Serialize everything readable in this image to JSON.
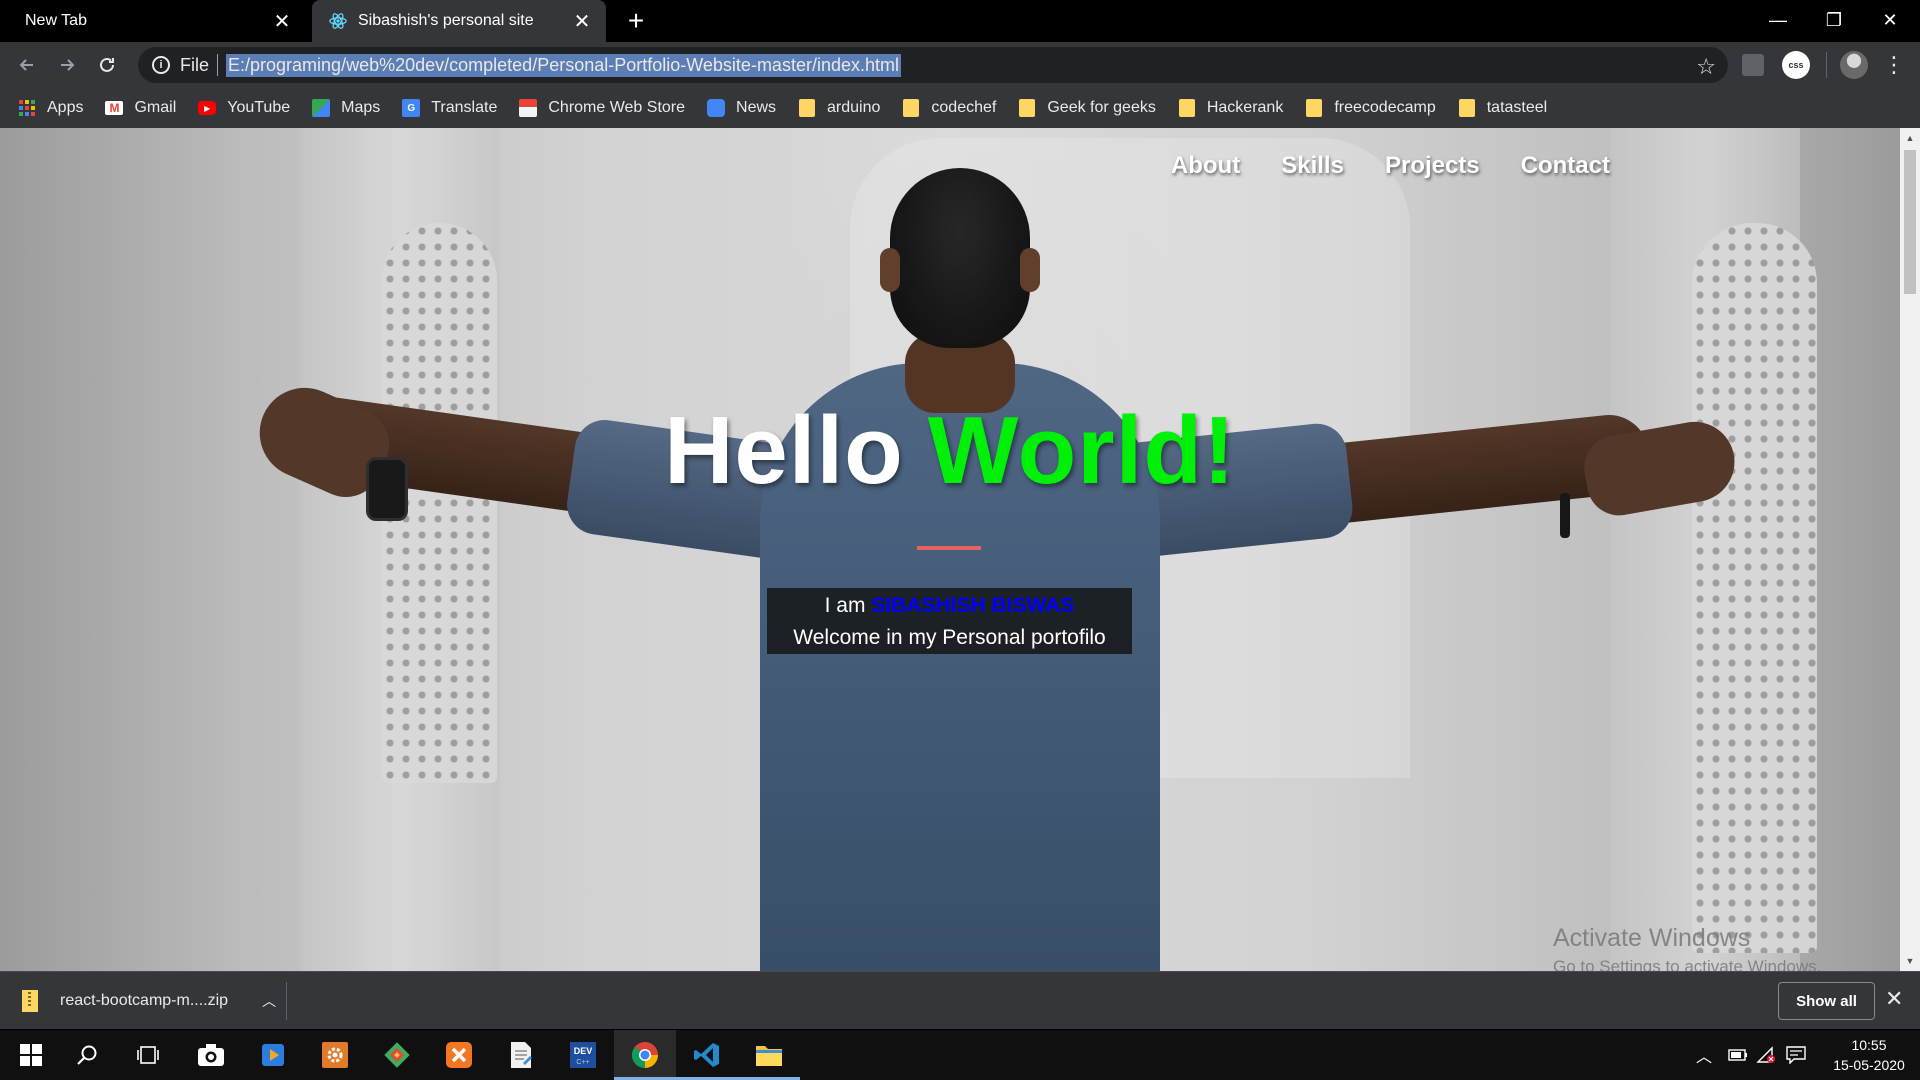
{
  "browser": {
    "tabs": [
      {
        "label": "New Tab",
        "active": false
      },
      {
        "label": "Sibashish's personal site",
        "active": true
      }
    ],
    "window_controls": {
      "minimize": "—",
      "restore": "❐",
      "close": "✕"
    },
    "address_bar": {
      "scheme_label": "File",
      "url": "E:/programing/web%20dev/completed/Personal-Portfolio-Website-master/index.html"
    },
    "extension_badge": "css",
    "bookmarks": [
      {
        "label": "Apps",
        "icon": "apps-grid-icon"
      },
      {
        "label": "Gmail",
        "icon": "gmail-icon"
      },
      {
        "label": "YouTube",
        "icon": "youtube-icon"
      },
      {
        "label": "Maps",
        "icon": "maps-icon"
      },
      {
        "label": "Translate",
        "icon": "translate-icon"
      },
      {
        "label": "Chrome Web Store",
        "icon": "web-store-icon"
      },
      {
        "label": "News",
        "icon": "news-icon"
      },
      {
        "label": "arduino",
        "icon": "folder-icon"
      },
      {
        "label": "codechef",
        "icon": "folder-icon"
      },
      {
        "label": "Geek for geeks",
        "icon": "folder-icon"
      },
      {
        "label": "Hackerank",
        "icon": "folder-icon"
      },
      {
        "label": "freecodecamp",
        "icon": "folder-icon"
      },
      {
        "label": "tatasteel",
        "icon": "folder-icon"
      }
    ]
  },
  "page": {
    "nav": [
      "About",
      "Skills",
      "Projects",
      "Contact"
    ],
    "hero": {
      "word1": "Hello",
      "word2": "World!",
      "intro_prefix": "I am",
      "intro_name": "SIBASHISH BISWAS",
      "tagline": "Welcome in my Personal portofilo"
    },
    "colors": {
      "highlight_green": "#00f00a",
      "name_blue": "#0000ff",
      "rule_red": "#e8625f"
    }
  },
  "watermark": {
    "line1": "Activate Windows",
    "line2": "Go to Settings to activate Windows."
  },
  "downloads": {
    "file": "react-bootcamp-m....zip",
    "show_all": "Show all"
  },
  "taskbar": {
    "apps": [
      "windows-start",
      "search",
      "task-view",
      "camera",
      "media-player",
      "settings-app",
      "git-app",
      "xampp",
      "notepad",
      "dev-cpp",
      "chrome",
      "vscode",
      "file-explorer"
    ],
    "clock_time": "10:55",
    "clock_date": "15-05-2020"
  }
}
